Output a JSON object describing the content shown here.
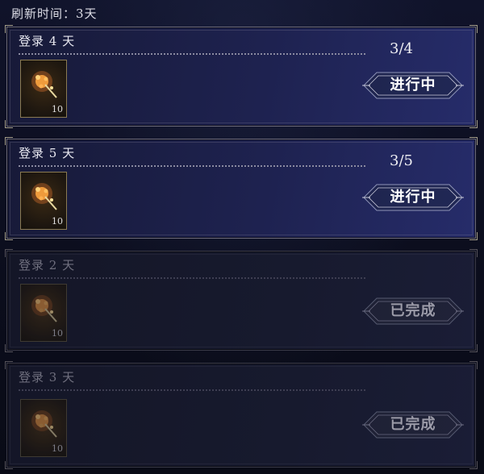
{
  "header": {
    "refresh_label": "刷新时间：3天"
  },
  "quests": [
    {
      "title": "登录 4 天",
      "progress": "3/4",
      "status": "进行中",
      "reward_qty": "10",
      "reward_icon": "firework-icon",
      "state": "in-progress"
    },
    {
      "title": "登录 5 天",
      "progress": "3/5",
      "status": "进行中",
      "reward_qty": "10",
      "reward_icon": "firework-icon",
      "state": "in-progress"
    },
    {
      "title": "登录 2 天",
      "progress": "",
      "status": "已完成",
      "reward_qty": "10",
      "reward_icon": "firework-icon",
      "state": "completed"
    },
    {
      "title": "登录 3 天",
      "progress": "",
      "status": "已完成",
      "reward_qty": "10",
      "reward_icon": "firework-icon",
      "state": "completed"
    }
  ],
  "colors": {
    "active_panel": "#1e2250",
    "completed_panel": "#171a2e",
    "frame_gold": "#a39d8a",
    "reward_border": "#8a7a52"
  }
}
